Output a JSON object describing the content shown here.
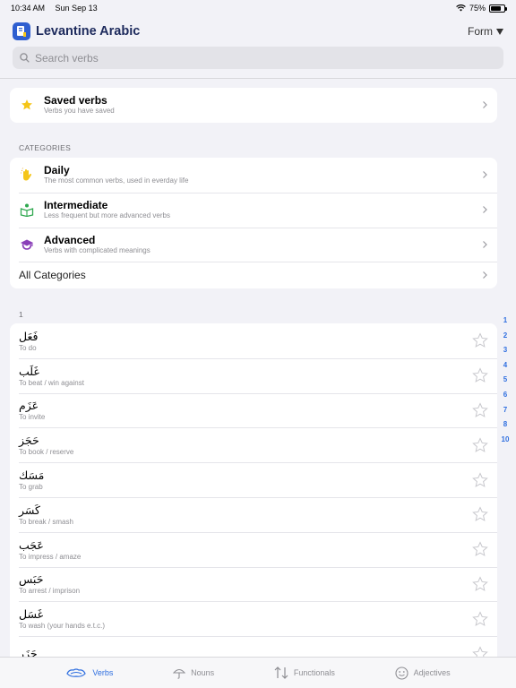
{
  "status": {
    "time": "10:34 AM",
    "date": "Sun Sep 13",
    "battery": "75%",
    "battery_level": 0.75
  },
  "header": {
    "title": "Levantine Arabic",
    "form_label": "Form"
  },
  "search": {
    "placeholder": "Search verbs"
  },
  "saved": {
    "title": "Saved verbs",
    "subtitle": "Verbs you have saved"
  },
  "categories": {
    "label": "CATEGORIES",
    "items": [
      {
        "title": "Daily",
        "subtitle": "The most common verbs, used in everday life"
      },
      {
        "title": "Intermediate",
        "subtitle": "Less frequent but more advanced verbs"
      },
      {
        "title": "Advanced",
        "subtitle": "Verbs with complicated meanings"
      }
    ],
    "all_label": "All Categories"
  },
  "verbs": {
    "section": "1",
    "items": [
      {
        "arabic": "فَعَل",
        "english": "To do"
      },
      {
        "arabic": "غَلَب",
        "english": "To beat / win against"
      },
      {
        "arabic": "عَزَم",
        "english": "To invite"
      },
      {
        "arabic": "حَجَز",
        "english": "To book / reserve"
      },
      {
        "arabic": "مَسَك",
        "english": "To grab"
      },
      {
        "arabic": "كَسَر",
        "english": "To break / smash"
      },
      {
        "arabic": "عَجَب",
        "english": "To impress / amaze"
      },
      {
        "arabic": "حَبَس",
        "english": "To arrest / imprison"
      },
      {
        "arabic": "غَسَل",
        "english": "To wash (your hands e.t.c.)"
      },
      {
        "arabic": "حَزَر",
        "english": ""
      }
    ]
  },
  "index": [
    "1",
    "2",
    "3",
    "4",
    "5",
    "6",
    "7",
    "8",
    "10"
  ],
  "tabs": [
    {
      "label": "Verbs",
      "active": true
    },
    {
      "label": "Nouns",
      "active": false
    },
    {
      "label": "Functionals",
      "active": false
    },
    {
      "label": "Adjectives",
      "active": false
    }
  ],
  "colors": {
    "accent": "#2f6fe0",
    "star": "#f5c518",
    "title": "#1d2a5c"
  }
}
